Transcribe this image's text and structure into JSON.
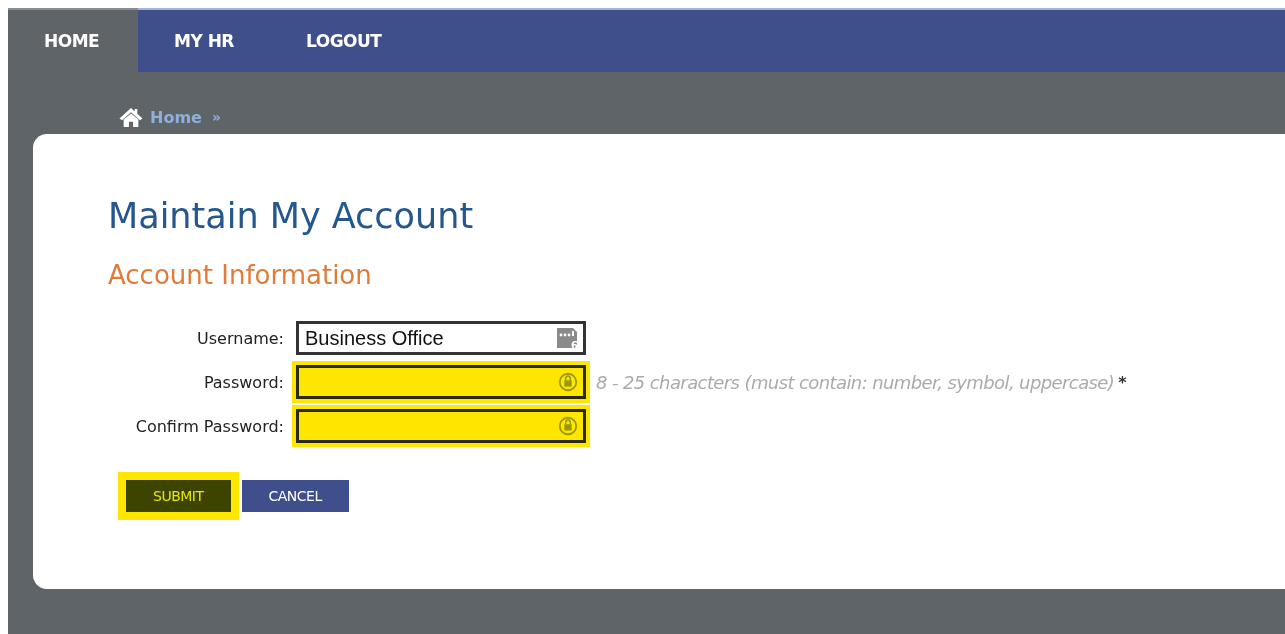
{
  "nav": {
    "tabs": [
      {
        "label": "HOME",
        "selected": true
      },
      {
        "label": "MY HR",
        "selected": false
      },
      {
        "label": "LOGOUT",
        "selected": false
      }
    ]
  },
  "breadcrumb": {
    "items": [
      "Home"
    ],
    "separator": "»"
  },
  "page_title": "Maintain My Account",
  "section_title": "Account Information",
  "form": {
    "fields": [
      {
        "label": "Username:",
        "kind": "text",
        "value": "Business Office",
        "highlighted": false,
        "badge": "6"
      },
      {
        "label": "Password:",
        "kind": "password",
        "highlighted": true,
        "hint": "8 - 25 characters (must contain: number, symbol, uppercase)",
        "required_mark": "*"
      },
      {
        "label": "Confirm Password:",
        "kind": "password",
        "highlighted": true
      }
    ]
  },
  "buttons": [
    {
      "label": "SUBMIT",
      "kind": "primary",
      "highlighted": true
    },
    {
      "label": "CANCEL",
      "kind": "secondary",
      "highlighted": false
    }
  ]
}
